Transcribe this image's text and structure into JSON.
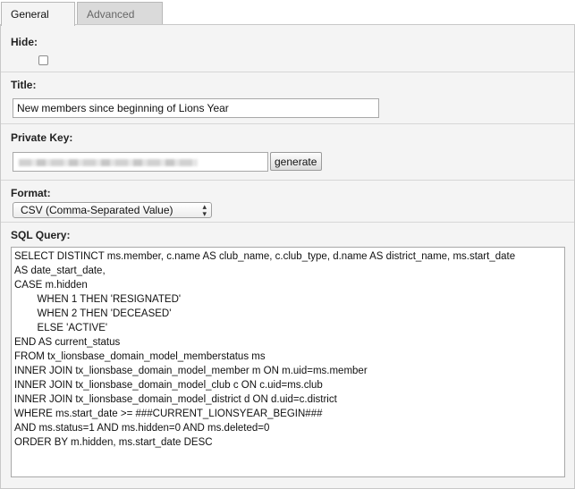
{
  "tabs": [
    {
      "label": "General",
      "active": true
    },
    {
      "label": "Advanced",
      "active": false
    }
  ],
  "fields": {
    "hide": {
      "label": "Hide:",
      "checked": false
    },
    "title": {
      "label": "Title:",
      "value": "New members since beginning of Lions Year"
    },
    "private_key": {
      "label": "Private Key:",
      "value": "",
      "generate_label": "generate"
    },
    "format": {
      "label": "Format:",
      "selected": "CSV (Comma-Separated Value)"
    },
    "sql_query": {
      "label": "SQL Query:",
      "lines": [
        "SELECT DISTINCT ms.member, c.name AS club_name, c.club_type, d.name AS district_name, ms.start_date",
        "AS date_start_date,",
        "CASE m.hidden",
        "        WHEN 1 THEN 'RESIGNATED'",
        "        WHEN 2 THEN 'DECEASED'",
        "        ELSE 'ACTIVE'",
        "END AS current_status",
        "FROM tx_lionsbase_domain_model_memberstatus ms",
        "INNER JOIN tx_lionsbase_domain_model_member m ON m.uid=ms.member",
        "INNER JOIN tx_lionsbase_domain_model_club c ON c.uid=ms.club",
        "INNER JOIN tx_lionsbase_domain_model_district d ON d.uid=c.district",
        "WHERE ms.start_date >= ###CURRENT_LIONSYEAR_BEGIN###",
        "AND ms.status=1 AND ms.hidden=0 AND ms.deleted=0",
        "ORDER BY m.hidden, ms.start_date DESC"
      ]
    }
  }
}
